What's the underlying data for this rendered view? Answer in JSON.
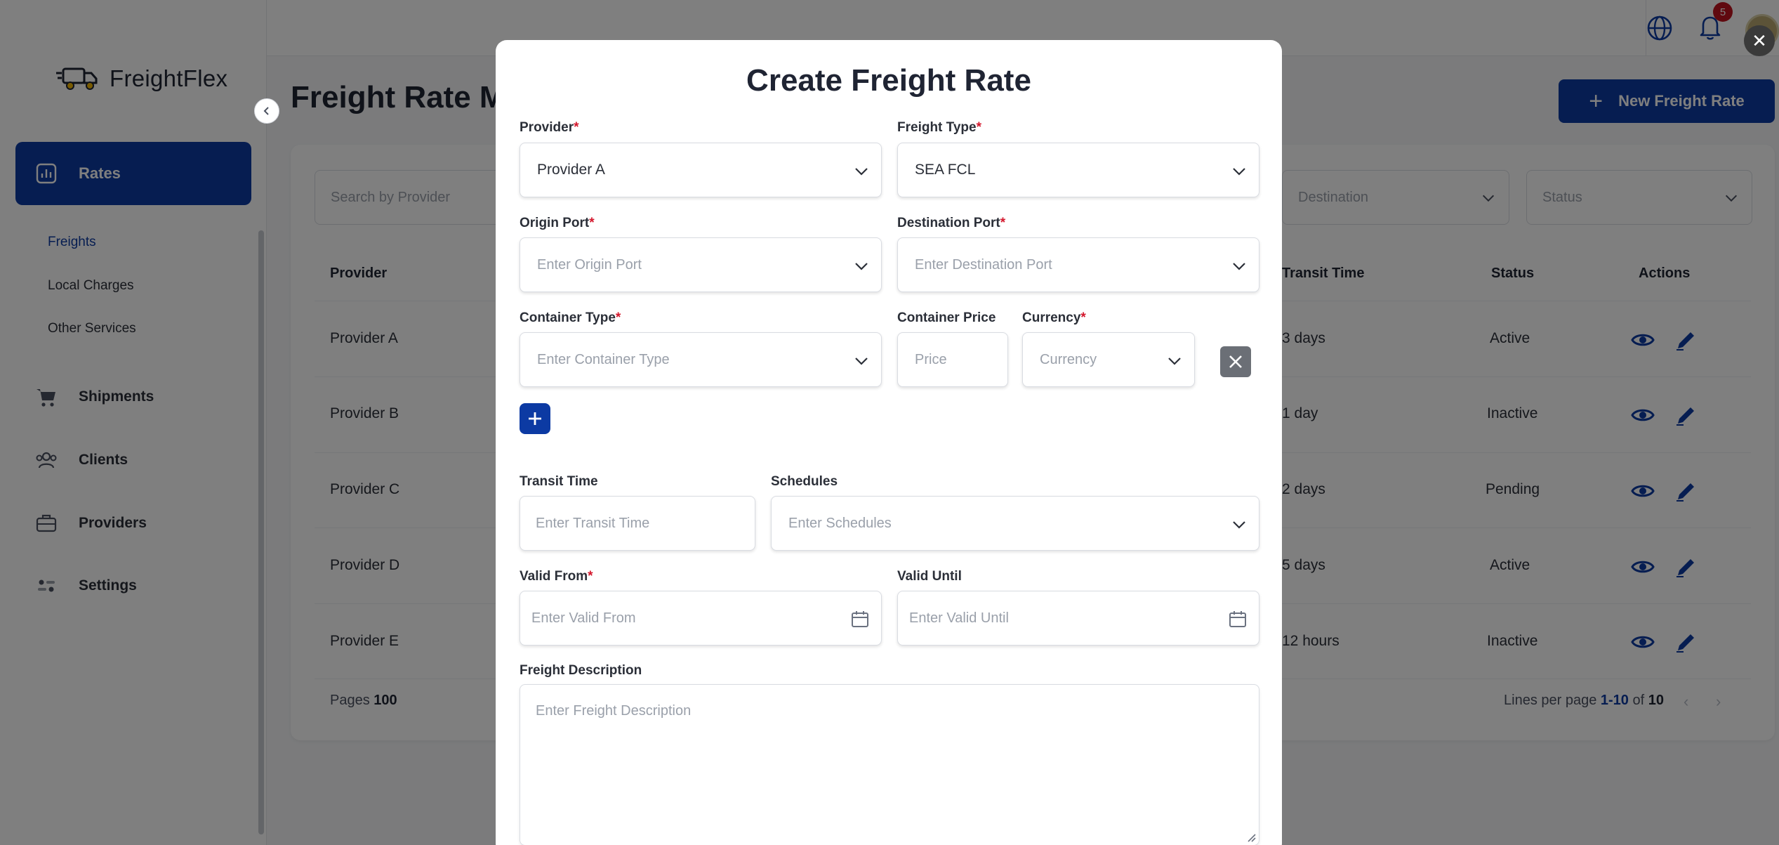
{
  "app": {
    "name": "FreightFlex",
    "notification_count": "5"
  },
  "sidebar": {
    "active_item": "Rates",
    "sub_items": [
      "Freights",
      "Local Charges",
      "Other Services"
    ],
    "items": [
      "Shipments",
      "Clients",
      "Providers",
      "Settings"
    ]
  },
  "page": {
    "title": "Freight Rate M",
    "new_button": "New Freight Rate",
    "search_placeholder": "Search by Provider",
    "filters": [
      "Destination",
      "Status"
    ],
    "columns": [
      "Provider",
      "Transit Time",
      "Status",
      "Actions"
    ],
    "rows": [
      {
        "provider": "Provider A",
        "transit": "3 days",
        "status": "Active"
      },
      {
        "provider": "Provider B",
        "transit": "1 day",
        "status": "Inactive"
      },
      {
        "provider": "Provider C",
        "transit": "2 days",
        "status": "Pending"
      },
      {
        "provider": "Provider D",
        "transit": "5 days",
        "status": "Active"
      },
      {
        "provider": "Provider E",
        "transit": "12 hours",
        "status": "Inactive"
      }
    ],
    "pages_label": "Pages",
    "pages_value": "100",
    "lines_label": "Lines per page",
    "lines_range": "1-10",
    "lines_of": "of",
    "lines_total": "10"
  },
  "modal": {
    "title": "Create Freight Rate",
    "provider": {
      "label": "Provider",
      "value": "Provider A"
    },
    "freight_type": {
      "label": "Freight Type",
      "value": "SEA FCL"
    },
    "origin_port": {
      "label": "Origin Port",
      "placeholder": "Enter Origin Port"
    },
    "destination_port": {
      "label": "Destination Port",
      "placeholder": "Enter Destination Port"
    },
    "container_type": {
      "label": "Container Type",
      "placeholder": "Enter Container Type"
    },
    "container_price": {
      "label": "Container Price",
      "placeholder": "Price"
    },
    "currency": {
      "label": "Currency",
      "placeholder": "Currency"
    },
    "transit_time": {
      "label": "Transit Time",
      "placeholder": "Enter Transit Time"
    },
    "schedules": {
      "label": "Schedules",
      "placeholder": "Enter Schedules"
    },
    "valid_from": {
      "label": "Valid From",
      "placeholder": "Enter Valid From"
    },
    "valid_until": {
      "label": "Valid Until",
      "placeholder": "Enter Valid Until"
    },
    "description": {
      "label": "Freight Description",
      "placeholder": "Enter Freight Description"
    },
    "required_mark": "*"
  },
  "colors": {
    "primary": "#0c3aa3",
    "required": "#d4182d",
    "badge": "#c1121f"
  }
}
